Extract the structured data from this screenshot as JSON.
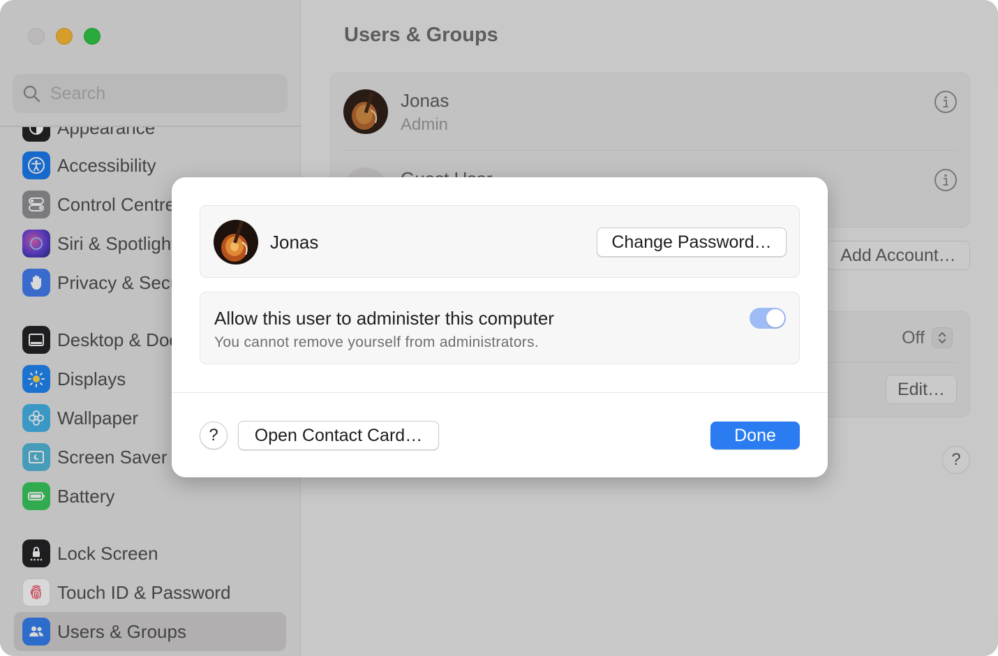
{
  "window": {
    "traffic_lights": [
      "close",
      "minimize",
      "zoom"
    ]
  },
  "sidebar": {
    "search_placeholder": "Search",
    "items": [
      {
        "label": "Appearance",
        "icon": "appearance-icon",
        "color": "#1d1d1f"
      },
      {
        "label": "Accessibility",
        "icon": "accessibility-icon",
        "color": "#1478f0"
      },
      {
        "label": "Control Centre",
        "icon": "control-centre-icon",
        "color": "#8e8e93"
      },
      {
        "label": "Siri & Spotlight",
        "icon": "siri-icon",
        "color": "#6b3bd6"
      },
      {
        "label": "Privacy & Security",
        "icon": "hand-icon",
        "color": "#3d7bf2"
      },
      {
        "label": "Desktop & Dock",
        "icon": "dock-icon",
        "color": "#1d1d1f"
      },
      {
        "label": "Displays",
        "icon": "sun-icon",
        "color": "#1a84f5"
      },
      {
        "label": "Wallpaper",
        "icon": "flower-icon",
        "color": "#3fb1e8"
      },
      {
        "label": "Screen Saver",
        "icon": "screen-saver-icon",
        "color": "#4fb8d9"
      },
      {
        "label": "Battery",
        "icon": "battery-icon",
        "color": "#35c759"
      },
      {
        "label": "Lock Screen",
        "icon": "lock-icon",
        "color": "#1d1d1f"
      },
      {
        "label": "Touch ID & Password",
        "icon": "fingerprint-icon",
        "color": "#ffffff"
      },
      {
        "label": "Users & Groups",
        "icon": "users-icon",
        "color": "#2f7cf0"
      }
    ],
    "active_item": "Users & Groups"
  },
  "main": {
    "title": "Users & Groups",
    "users": [
      {
        "name": "Jonas",
        "role": "Admin"
      },
      {
        "name": "Guest User",
        "role": ""
      }
    ],
    "add_account_label": "Add Account…",
    "auto_login_value": "Off",
    "edit_label": "Edit…",
    "help_label": "?"
  },
  "dialog": {
    "user_name": "Jonas",
    "change_password_label": "Change Password…",
    "admin_title": "Allow this user to administer this computer",
    "admin_subtitle": "You cannot remove yourself from administrators.",
    "admin_toggle_on": true,
    "help_label": "?",
    "open_contact_label": "Open Contact Card…",
    "done_label": "Done",
    "accent_color": "#2b7cf1"
  }
}
